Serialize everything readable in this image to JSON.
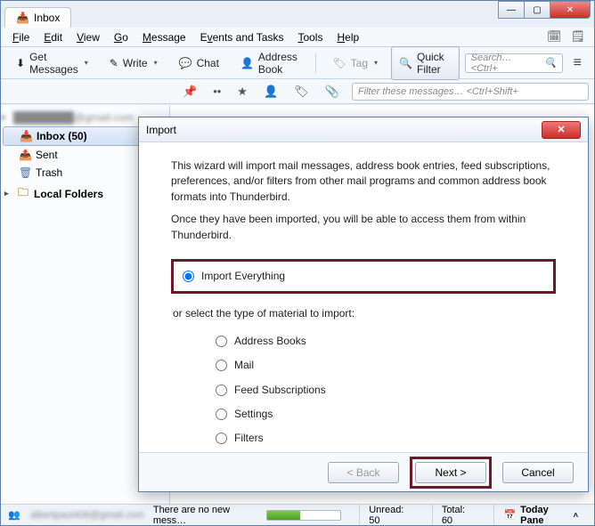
{
  "tab": {
    "label": "Inbox"
  },
  "menubar": [
    "File",
    "Edit",
    "View",
    "Go",
    "Message",
    "Events and Tasks",
    "Tools",
    "Help"
  ],
  "toolbar": {
    "get_messages": "Get Messages",
    "write": "Write",
    "chat": "Chat",
    "address_book": "Address Book",
    "tag": "Tag",
    "quick_filter": "Quick Filter",
    "search_placeholder": "Search…  <Ctrl+"
  },
  "filterbar": {
    "placeholder": "Filter these messages…  <Ctrl+Shift+"
  },
  "sidebar": {
    "account": "████████@gmail.com",
    "inbox": "Inbox (50)",
    "sent": "Sent",
    "trash": "Trash",
    "local": "Local Folders"
  },
  "dialog": {
    "title": "Import",
    "p1": "This wizard will import mail messages, address book entries, feed subscriptions, preferences, and/or filters from other mail programs and common address book formats into Thunderbird.",
    "p2": "Once they have been imported, you will be able to access them from within Thunderbird.",
    "opt_everything": "Import Everything",
    "subhead": "or select the type of material to import:",
    "options": [
      "Address Books",
      "Mail",
      "Feed Subscriptions",
      "Settings",
      "Filters"
    ],
    "back": "< Back",
    "next": "Next >",
    "cancel": "Cancel"
  },
  "status": {
    "msg": "There are no new mess…",
    "unread": "Unread: 50",
    "total": "Total: 60",
    "today": "Today Pane"
  }
}
